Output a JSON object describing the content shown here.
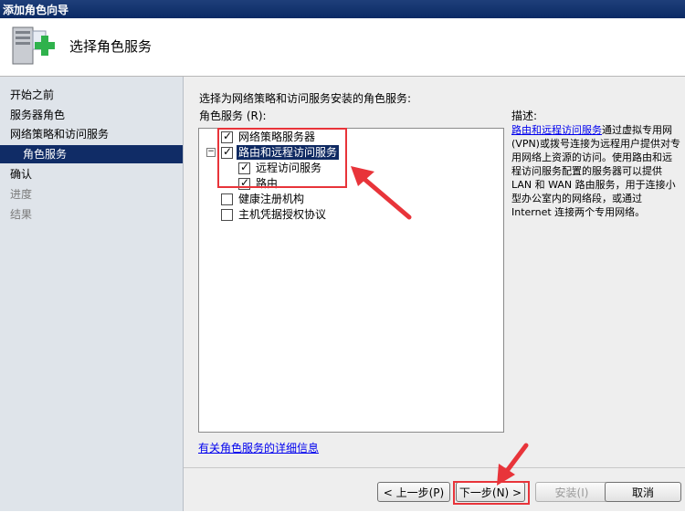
{
  "window": {
    "title": "添加角色向导"
  },
  "header": {
    "title": "选择角色服务",
    "icon": "server-add-icon"
  },
  "sidebar": {
    "steps": [
      {
        "label": "开始之前",
        "state": "done"
      },
      {
        "label": "服务器角色",
        "state": "done"
      },
      {
        "label": "网络策略和访问服务",
        "state": "done"
      },
      {
        "label": "角色服务",
        "state": "active"
      },
      {
        "label": "确认",
        "state": "done"
      },
      {
        "label": "进度",
        "state": "todo"
      },
      {
        "label": "结果",
        "state": "todo"
      }
    ]
  },
  "main": {
    "instruction": "选择为网络策略和访问服务安装的角色服务:",
    "list_label": "角色服务 (R):",
    "services": [
      {
        "label": "网络策略服务器",
        "checked": true
      },
      {
        "label": "路由和远程访问服务",
        "checked": true,
        "expanded": true,
        "selected": true
      },
      {
        "label": "远程访问服务",
        "checked": true
      },
      {
        "label": "路由",
        "checked": true
      },
      {
        "label": "健康注册机构",
        "checked": false
      },
      {
        "label": "主机凭据授权协议",
        "checked": false
      }
    ],
    "expander_symbol": "−",
    "more_info_link": "有关角色服务的详细信息"
  },
  "description": {
    "label": "描述:",
    "link": "路由和远程访问服务",
    "text": "通过虚拟专用网(VPN)或拨号连接为远程用户提供对专用网络上资源的访问。使用路由和远程访问服务配置的服务器可以提供 LAN 和 WAN 路由服务，用于连接小型办公室内的网络段，或通过 Internet 连接两个专用网络。"
  },
  "buttons": {
    "prev": "< 上一步(P)",
    "next": "下一步(N) >",
    "install": "安装(I)",
    "cancel": "取消"
  },
  "colors": {
    "annotation": "#e8343a",
    "selection": "#0f2a62",
    "sidebar": "#dfe4ea"
  }
}
